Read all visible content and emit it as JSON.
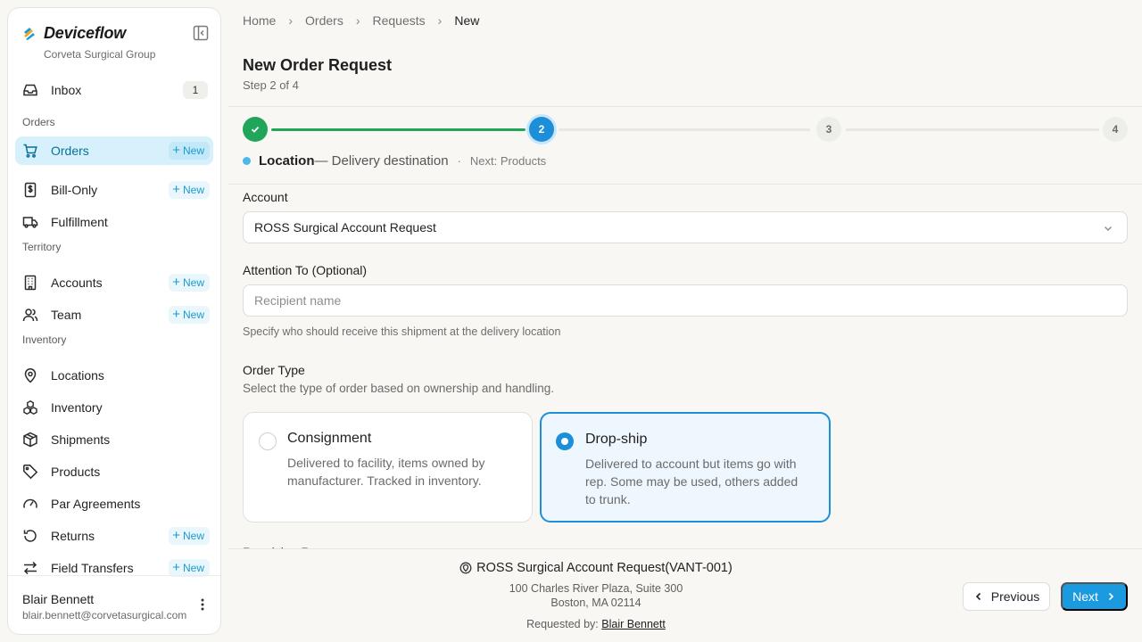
{
  "app": {
    "brand": "Deviceflow",
    "org": "Corveta Surgical Group"
  },
  "sidebar": {
    "inbox": {
      "label": "Inbox",
      "count": "1"
    },
    "sections": {
      "orders": "Orders",
      "territory": "Territory",
      "inventory": "Inventory"
    },
    "new_label": "New",
    "items": {
      "orders": "Orders",
      "bill_only": "Bill-Only",
      "fulfillment": "Fulfillment",
      "accounts": "Accounts",
      "team": "Team",
      "locations": "Locations",
      "inventory": "Inventory",
      "shipments": "Shipments",
      "products": "Products",
      "par_agreements": "Par Agreements",
      "returns": "Returns",
      "field_transfers": "Field Transfers"
    },
    "user": {
      "name": "Blair Bennett",
      "email": "blair.bennett@corvetasurgical.com"
    }
  },
  "breadcrumb": [
    "Home",
    "Orders",
    "Requests",
    "New"
  ],
  "page": {
    "title": "New Order Request",
    "subtitle": "Step 2 of 4"
  },
  "stepper": {
    "steps": [
      "1",
      "2",
      "3",
      "4"
    ],
    "current_step": 2,
    "current_title": "Location",
    "current_desc": "— Delivery destination",
    "next_text": "Next: Products",
    "separator": "·"
  },
  "form": {
    "account": {
      "label": "Account",
      "value": "ROSS Surgical Account Request"
    },
    "attention": {
      "label": "Attention To (Optional)",
      "placeholder": "Recipient name",
      "value": "",
      "helper": "Specify who should receive this shipment at the delivery location"
    },
    "order_type": {
      "label": "Order Type",
      "helper": "Select the type of order based on ownership and handling.",
      "selected": "Drop-ship",
      "options": [
        {
          "title": "Consignment",
          "desc": "Delivered to facility, items owned by manufacturer. Tracked in inventory."
        },
        {
          "title": "Drop-ship",
          "desc": "Delivered to account but items go with rep. Some may be used, others added to trunk."
        }
      ]
    },
    "next_section_label": "Receiving Rep"
  },
  "footer": {
    "account_name": "ROSS Surgical Account Request(VANT-001)",
    "address_line1": "100 Charles River Plaza, Suite 300",
    "address_line2": "Boston, MA 02114",
    "requested_by_label": "Requested by:",
    "requested_by": "Blair Bennett",
    "prev_label": "Previous",
    "next_label": "Next"
  },
  "colors": {
    "accent": "#1d8fd8",
    "active_nav_bg": "#d6f1fb",
    "success": "#21a55a",
    "new_pill_text": "#1b9ad1"
  }
}
